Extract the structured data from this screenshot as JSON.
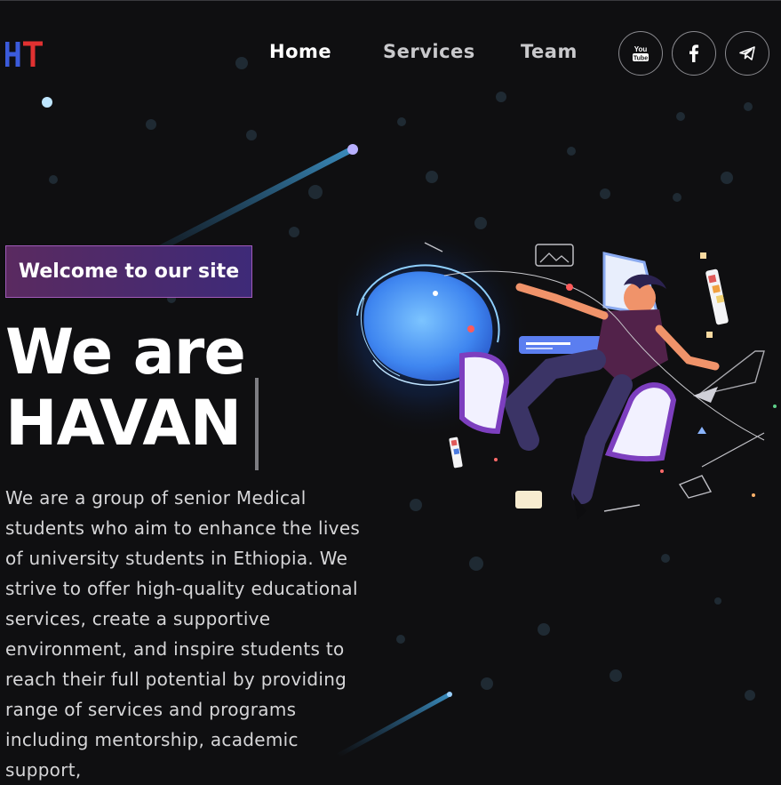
{
  "header": {
    "logo_text": "HT",
    "nav": [
      {
        "label": "Home",
        "active": true
      },
      {
        "label": "Services",
        "active": false
      },
      {
        "label": "Team",
        "active": false
      }
    ],
    "social": [
      {
        "icon": "youtube-icon",
        "text": "You Tube"
      },
      {
        "icon": "facebook-icon"
      },
      {
        "icon": "telegram-icon"
      }
    ]
  },
  "hero": {
    "badge": "Welcome to our site",
    "title_line1": "We are",
    "title_line2": "HAVAN",
    "description": "We are a group of senior Medical students who aim to enhance the lives of university students in Ethiopia. We strive to offer high-quality educational services, create a supportive environment, and inspire students to reach their full potential by providing range of services and programs including mentorship, academic support,"
  },
  "colors": {
    "background": "#0f0f11",
    "logo_h": "#3b5bdb",
    "logo_t": "#e03131",
    "badge_gradient": [
      "#5a2a60",
      "#3e2a78"
    ],
    "accent_blue": "#5aa8ff"
  }
}
